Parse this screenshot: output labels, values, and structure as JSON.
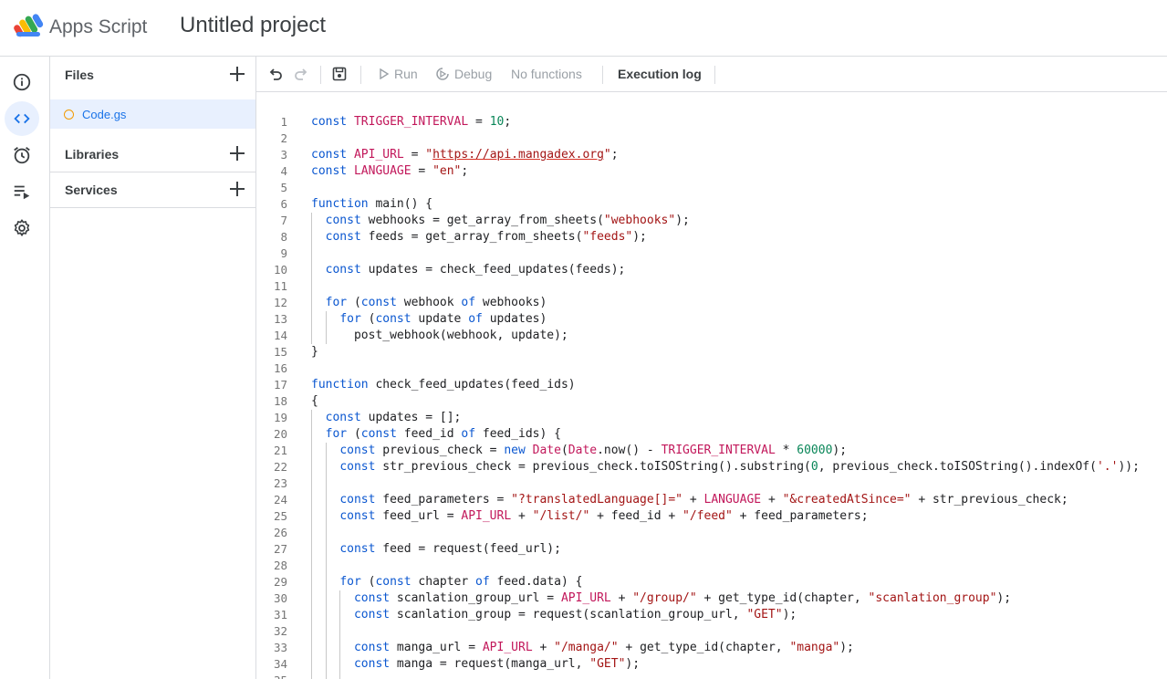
{
  "header": {
    "app_name": "Apps Script",
    "project_title": "Untitled project"
  },
  "rail": {
    "items": [
      {
        "name": "overview",
        "icon": "info-icon"
      },
      {
        "name": "editor",
        "icon": "code-icon",
        "active": true
      },
      {
        "name": "triggers",
        "icon": "alarm-clock-icon"
      },
      {
        "name": "executions",
        "icon": "playlist-icon"
      },
      {
        "name": "settings",
        "icon": "gear-icon"
      }
    ]
  },
  "files_panel": {
    "files_label": "Files",
    "files": [
      {
        "name": "Code.gs",
        "selected": true
      }
    ],
    "libraries_label": "Libraries",
    "services_label": "Services"
  },
  "toolbar": {
    "run_label": "Run",
    "debug_label": "Debug",
    "function_select": "No functions",
    "execution_log_label": "Execution log"
  },
  "colors": {
    "keyword": "#0b57d0",
    "variable": "#c2185b",
    "string": "#a31515",
    "number": "#098658",
    "selection": "#e8f0fe",
    "accent": "#1a73e8"
  },
  "editor": {
    "lines": [
      [
        [
          "kw",
          "const"
        ],
        [
          "t",
          " "
        ],
        [
          "var",
          "TRIGGER_INTERVAL"
        ],
        [
          "t",
          " = "
        ],
        [
          "num",
          "10"
        ],
        [
          "t",
          ";"
        ]
      ],
      [],
      [
        [
          "kw",
          "const"
        ],
        [
          "t",
          " "
        ],
        [
          "var",
          "API_URL"
        ],
        [
          "t",
          " = "
        ],
        [
          "str",
          "\""
        ],
        [
          "url",
          "https://api.mangadex.org"
        ],
        [
          "str",
          "\""
        ],
        [
          "t",
          ";"
        ]
      ],
      [
        [
          "kw",
          "const"
        ],
        [
          "t",
          " "
        ],
        [
          "var",
          "LANGUAGE"
        ],
        [
          "t",
          " = "
        ],
        [
          "str",
          "\"en\""
        ],
        [
          "t",
          ";"
        ]
      ],
      [],
      [
        [
          "kw",
          "function"
        ],
        [
          "t",
          " main() {"
        ]
      ],
      [
        [
          "t",
          "  "
        ],
        [
          "kw",
          "const"
        ],
        [
          "t",
          " webhooks = get_array_from_sheets("
        ],
        [
          "str",
          "\"webhooks\""
        ],
        [
          "t",
          ");"
        ]
      ],
      [
        [
          "t",
          "  "
        ],
        [
          "kw",
          "const"
        ],
        [
          "t",
          " feeds = get_array_from_sheets("
        ],
        [
          "str",
          "\"feeds\""
        ],
        [
          "t",
          ");"
        ]
      ],
      [],
      [
        [
          "t",
          "  "
        ],
        [
          "kw",
          "const"
        ],
        [
          "t",
          " updates = check_feed_updates(feeds);"
        ]
      ],
      [],
      [
        [
          "t",
          "  "
        ],
        [
          "kw",
          "for"
        ],
        [
          "t",
          " ("
        ],
        [
          "kw",
          "const"
        ],
        [
          "t",
          " webhook "
        ],
        [
          "kw",
          "of"
        ],
        [
          "t",
          " webhooks)"
        ]
      ],
      [
        [
          "t",
          "    "
        ],
        [
          "kw",
          "for"
        ],
        [
          "t",
          " ("
        ],
        [
          "kw",
          "const"
        ],
        [
          "t",
          " update "
        ],
        [
          "kw",
          "of"
        ],
        [
          "t",
          " updates)"
        ]
      ],
      [
        [
          "t",
          "      post_webhook(webhook, update);"
        ]
      ],
      [
        [
          "t",
          "}"
        ]
      ],
      [],
      [
        [
          "kw",
          "function"
        ],
        [
          "t",
          " check_feed_updates(feed_ids)"
        ]
      ],
      [
        [
          "t",
          "{"
        ]
      ],
      [
        [
          "t",
          "  "
        ],
        [
          "kw",
          "const"
        ],
        [
          "t",
          " updates = [];"
        ]
      ],
      [
        [
          "t",
          "  "
        ],
        [
          "kw",
          "for"
        ],
        [
          "t",
          " ("
        ],
        [
          "kw",
          "const"
        ],
        [
          "t",
          " feed_id "
        ],
        [
          "kw",
          "of"
        ],
        [
          "t",
          " feed_ids) {"
        ]
      ],
      [
        [
          "t",
          "    "
        ],
        [
          "kw",
          "const"
        ],
        [
          "t",
          " previous_check = "
        ],
        [
          "kw",
          "new"
        ],
        [
          "t",
          " "
        ],
        [
          "var",
          "Date"
        ],
        [
          "t",
          "("
        ],
        [
          "var",
          "Date"
        ],
        [
          "t",
          ".now() - "
        ],
        [
          "var",
          "TRIGGER_INTERVAL"
        ],
        [
          "t",
          " * "
        ],
        [
          "num",
          "60000"
        ],
        [
          "t",
          ");"
        ]
      ],
      [
        [
          "t",
          "    "
        ],
        [
          "kw",
          "const"
        ],
        [
          "t",
          " str_previous_check = previous_check.toISOString().substring("
        ],
        [
          "num",
          "0"
        ],
        [
          "t",
          ", previous_check.toISOString().indexOf("
        ],
        [
          "str",
          "'.'"
        ],
        [
          "t",
          "));"
        ]
      ],
      [],
      [
        [
          "t",
          "    "
        ],
        [
          "kw",
          "const"
        ],
        [
          "t",
          " feed_parameters = "
        ],
        [
          "str",
          "\"?translatedLanguage[]=\""
        ],
        [
          "t",
          " + "
        ],
        [
          "var",
          "LANGUAGE"
        ],
        [
          "t",
          " + "
        ],
        [
          "str",
          "\"&createdAtSince=\""
        ],
        [
          "t",
          " + str_previous_check;"
        ]
      ],
      [
        [
          "t",
          "    "
        ],
        [
          "kw",
          "const"
        ],
        [
          "t",
          " feed_url = "
        ],
        [
          "var",
          "API_URL"
        ],
        [
          "t",
          " + "
        ],
        [
          "str",
          "\"/list/\""
        ],
        [
          "t",
          " + feed_id + "
        ],
        [
          "str",
          "\"/feed\""
        ],
        [
          "t",
          " + feed_parameters;"
        ]
      ],
      [],
      [
        [
          "t",
          "    "
        ],
        [
          "kw",
          "const"
        ],
        [
          "t",
          " feed = request(feed_url);"
        ]
      ],
      [],
      [
        [
          "t",
          "    "
        ],
        [
          "kw",
          "for"
        ],
        [
          "t",
          " ("
        ],
        [
          "kw",
          "const"
        ],
        [
          "t",
          " chapter "
        ],
        [
          "kw",
          "of"
        ],
        [
          "t",
          " feed.data) {"
        ]
      ],
      [
        [
          "t",
          "      "
        ],
        [
          "kw",
          "const"
        ],
        [
          "t",
          " scanlation_group_url = "
        ],
        [
          "var",
          "API_URL"
        ],
        [
          "t",
          " + "
        ],
        [
          "str",
          "\"/group/\""
        ],
        [
          "t",
          " + get_type_id(chapter, "
        ],
        [
          "str",
          "\"scanlation_group\""
        ],
        [
          "t",
          ");"
        ]
      ],
      [
        [
          "t",
          "      "
        ],
        [
          "kw",
          "const"
        ],
        [
          "t",
          " scanlation_group = request(scanlation_group_url, "
        ],
        [
          "str",
          "\"GET\""
        ],
        [
          "t",
          ");"
        ]
      ],
      [],
      [
        [
          "t",
          "      "
        ],
        [
          "kw",
          "const"
        ],
        [
          "t",
          " manga_url = "
        ],
        [
          "var",
          "API_URL"
        ],
        [
          "t",
          " + "
        ],
        [
          "str",
          "\"/manga/\""
        ],
        [
          "t",
          " + get_type_id(chapter, "
        ],
        [
          "str",
          "\"manga\""
        ],
        [
          "t",
          ");"
        ]
      ],
      [
        [
          "t",
          "      "
        ],
        [
          "kw",
          "const"
        ],
        [
          "t",
          " manga = request(manga_url, "
        ],
        [
          "str",
          "\"GET\""
        ],
        [
          "t",
          ");"
        ]
      ],
      []
    ]
  }
}
